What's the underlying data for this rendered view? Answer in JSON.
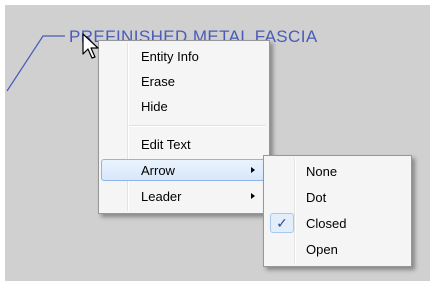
{
  "drawing": {
    "label": "PREFINISHED METAL FASCIA"
  },
  "context_menu": {
    "items": [
      {
        "label": "Entity Info"
      },
      {
        "label": "Erase"
      },
      {
        "label": "Hide"
      },
      {
        "label": "Edit Text"
      },
      {
        "label": "Arrow",
        "has_submenu": true,
        "highlighted": true
      },
      {
        "label": "Leader",
        "has_submenu": true
      }
    ]
  },
  "arrow_submenu": {
    "items": [
      {
        "label": "None"
      },
      {
        "label": "Dot"
      },
      {
        "label": "Closed",
        "checked": true,
        "check_glyph": "✓"
      },
      {
        "label": "Open"
      }
    ]
  },
  "colors": {
    "canvas": "#cfd0cf",
    "label_text": "#4a5bb8",
    "highlight": "#d7e8fb"
  },
  "icons": [
    "submenu-arrow-icon",
    "checkmark-icon",
    "mouse-pointer-icon"
  ]
}
